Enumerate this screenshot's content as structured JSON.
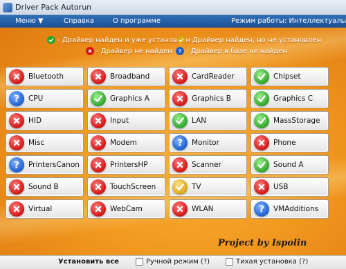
{
  "window": {
    "title": "Driver Pack Autorun"
  },
  "menu": {
    "items": [
      {
        "label": "Меню ▼"
      },
      {
        "label": "Справка"
      },
      {
        "label": "О программе"
      }
    ],
    "mode_label": "Режим работы: Интеллектуальный"
  },
  "legend": {
    "installed": "- Драйвер найден и уже установлен",
    "not_installed": "- Драйвер найден, но не установлен",
    "not_found": "- Драйвер не найден",
    "in_database": "- Драйвер в базе не найден"
  },
  "status_colors": {
    "red": "#d11515",
    "blue": "#1d5fd0",
    "green": "#2fa52a",
    "yellow": "#d9a615"
  },
  "drivers": [
    {
      "label": "Bluetooth",
      "status": "red"
    },
    {
      "label": "Broadband",
      "status": "red"
    },
    {
      "label": "CardReader",
      "status": "red"
    },
    {
      "label": "Chipset",
      "status": "green"
    },
    {
      "label": "CPU",
      "status": "blue"
    },
    {
      "label": "Graphics A",
      "status": "green"
    },
    {
      "label": "Graphics B",
      "status": "red"
    },
    {
      "label": "Graphics C",
      "status": "green"
    },
    {
      "label": "HID",
      "status": "red"
    },
    {
      "label": "Input",
      "status": "red"
    },
    {
      "label": "LAN",
      "status": "green"
    },
    {
      "label": "MassStorage",
      "status": "green"
    },
    {
      "label": "Misc",
      "status": "red"
    },
    {
      "label": "Modem",
      "status": "red"
    },
    {
      "label": "Monitor",
      "status": "blue"
    },
    {
      "label": "Phone",
      "status": "red"
    },
    {
      "label": "PrintersCanon",
      "status": "blue"
    },
    {
      "label": "PrintersHP",
      "status": "red"
    },
    {
      "label": "Scanner",
      "status": "red"
    },
    {
      "label": "Sound A",
      "status": "green"
    },
    {
      "label": "Sound B",
      "status": "red"
    },
    {
      "label": "TouchScreen",
      "status": "red"
    },
    {
      "label": "TV",
      "status": "yellow"
    },
    {
      "label": "USB",
      "status": "red"
    },
    {
      "label": "Virtual",
      "status": "red"
    },
    {
      "label": "WebCam",
      "status": "red"
    },
    {
      "label": "WLAN",
      "status": "red"
    },
    {
      "label": "VMAdditions",
      "status": "blue"
    }
  ],
  "credit": "Project by Ispolin",
  "bottom": {
    "install_all": "Установить все",
    "manual_mode": "Ручной режим (?)",
    "silent_install": "Тихая установка (?)"
  }
}
